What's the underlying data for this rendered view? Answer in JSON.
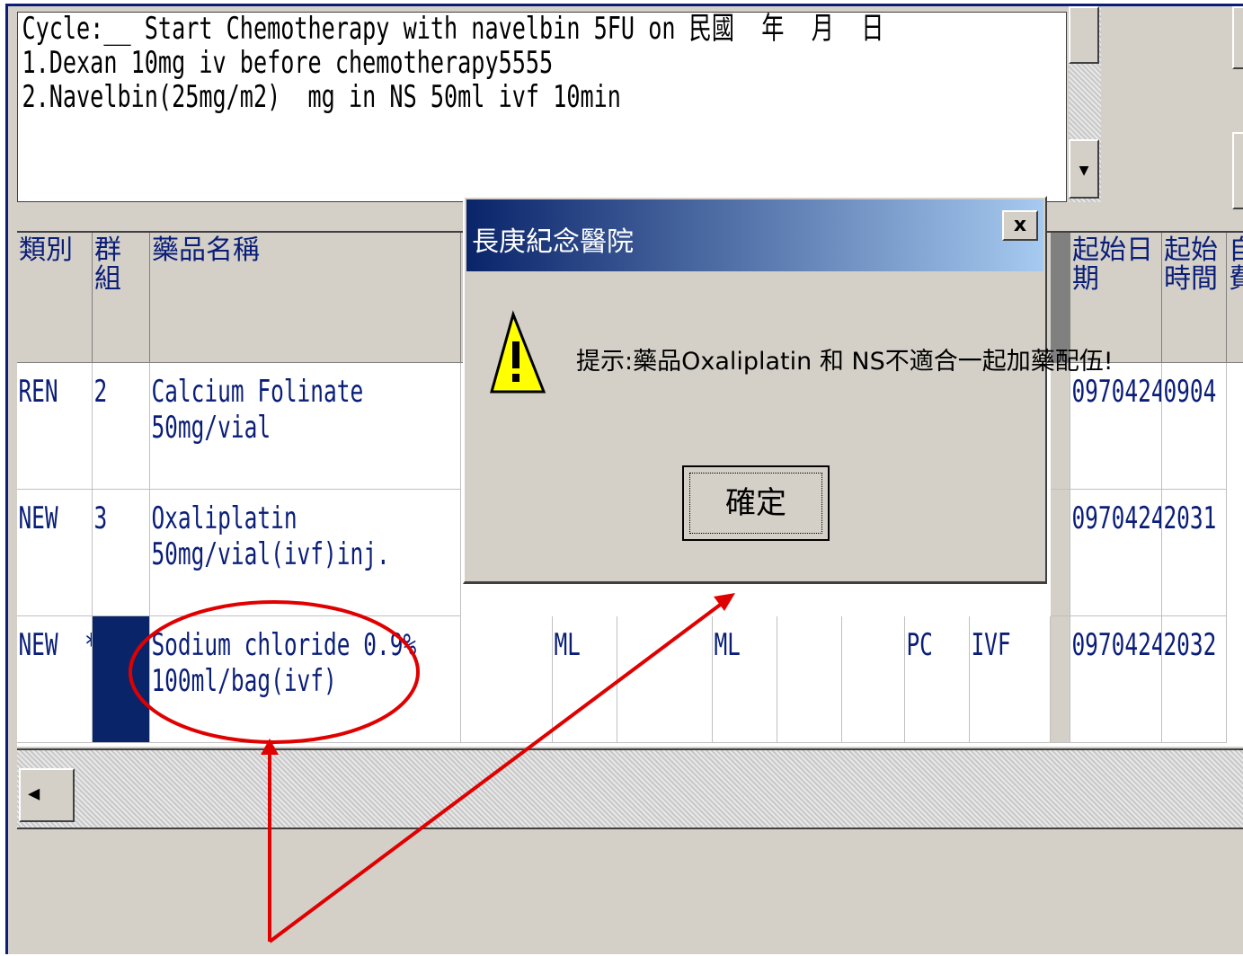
{
  "note": {
    "lines": [
      "Cycle:__ Start Chemotherapy with navelbin 5FU on 民國  年  月  日",
      "1.Dexan 10mg iv before chemotherapy5555",
      "2.Navelbin(25mg/m2)  mg in NS 50ml ivf 10min"
    ]
  },
  "grid": {
    "headers": {
      "category": "類別",
      "group": "群組",
      "drug_name": "藥品名稱",
      "start_date": "起始日期",
      "start_time": "起始時間",
      "self_pay": "自費"
    },
    "rows": [
      {
        "category": "REN",
        "group": "2",
        "drug_l1": "Calcium Folinate",
        "drug_l2": "50mg/vial",
        "unit1": "",
        "unit2": "",
        "freq": "",
        "route": "",
        "start_date": "0970424",
        "start_time": "0904"
      },
      {
        "category": "NEW",
        "group": "3",
        "drug_l1": "Oxaliplatin",
        "drug_l2": "50mg/vial(ivf)inj.",
        "unit1": "",
        "unit2": "",
        "freq": "",
        "route": "",
        "start_date": "0970424",
        "start_time": "2031"
      },
      {
        "category": "NEW  *",
        "group": "",
        "drug_l1": "Sodium chloride 0.9%",
        "drug_l2": "100ml/bag(ivf)",
        "unit1": "ML",
        "unit2": "ML",
        "freq": "PC",
        "route": "IVF",
        "start_date": "0970424",
        "start_time": "2032"
      }
    ]
  },
  "dialog": {
    "title": "長庚紀念醫院",
    "close": "x",
    "message": "提示:藥品Oxaliplatin 和 NS不適合一起加藥配伍!",
    "ok": "確定",
    "icon": "warning-icon"
  },
  "colors": {
    "text": "#0a1e78",
    "annotation": "#e00000",
    "selected_cell": "#0a246a"
  }
}
